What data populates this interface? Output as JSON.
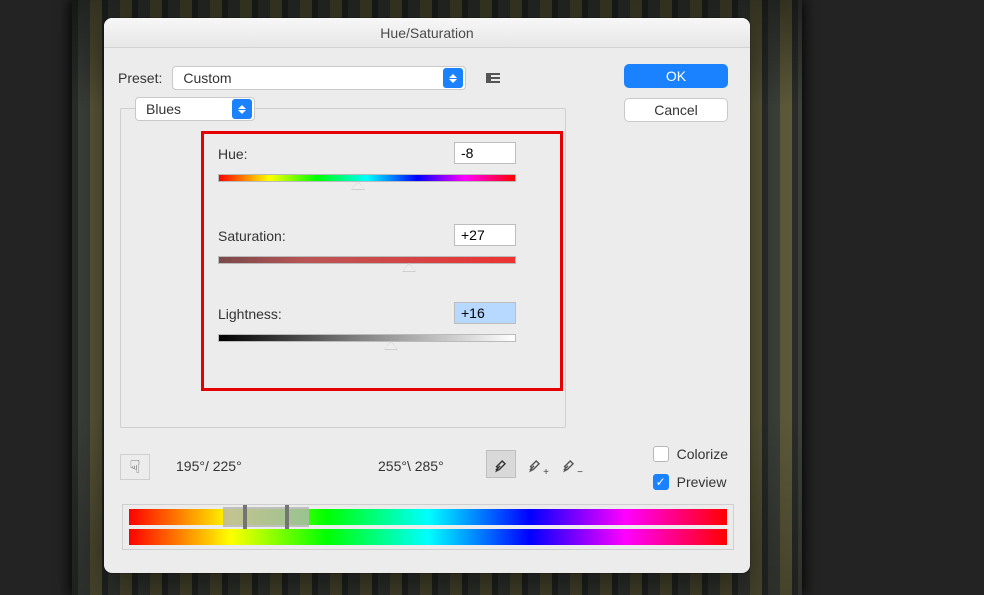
{
  "dialog": {
    "title": "Hue/Saturation",
    "preset_label": "Preset:",
    "preset_value": "Custom",
    "ok_label": "OK",
    "cancel_label": "Cancel",
    "range_value": "Blues"
  },
  "sliders": {
    "hue": {
      "label": "Hue:",
      "value": "-8",
      "thumb_pct": 47
    },
    "saturation": {
      "label": "Saturation:",
      "value": "+27",
      "thumb_pct": 64
    },
    "lightness": {
      "label": "Lightness:",
      "value": "+16",
      "thumb_pct": 58
    }
  },
  "range_readout": {
    "inner": "195°/ 225°",
    "outer": "255°\\ 285°"
  },
  "checks": {
    "colorize": {
      "label": "Colorize",
      "checked": false
    },
    "preview": {
      "label": "Preview",
      "checked": true
    }
  }
}
